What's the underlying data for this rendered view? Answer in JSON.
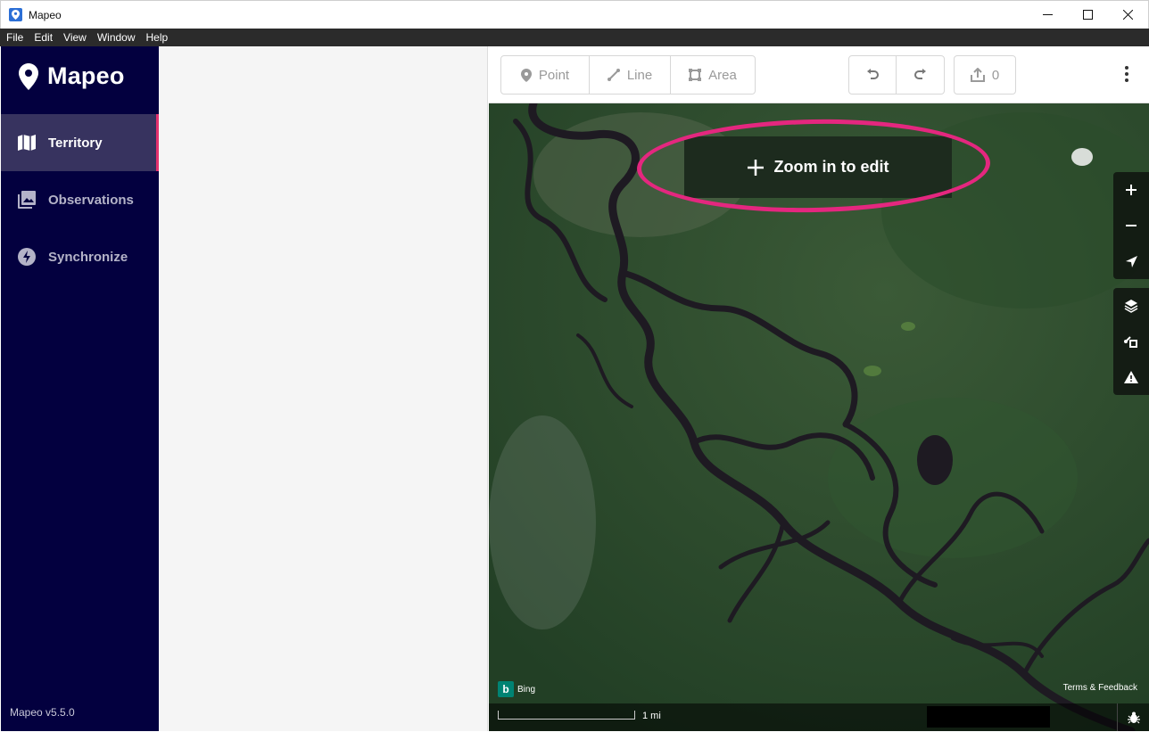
{
  "window": {
    "title": "Mapeo"
  },
  "menu": [
    "File",
    "Edit",
    "View",
    "Window",
    "Help"
  ],
  "sidebar": {
    "brand": "Mapeo",
    "items": [
      {
        "label": "Territory",
        "icon": "map-icon",
        "active": true
      },
      {
        "label": "Observations",
        "icon": "photo-library-icon",
        "active": false
      },
      {
        "label": "Synchronize",
        "icon": "flash-icon",
        "active": false
      }
    ],
    "version": "Mapeo v5.5.0"
  },
  "toolbar": {
    "point_label": "Point",
    "line_label": "Line",
    "area_label": "Area",
    "upload_count": "0"
  },
  "map": {
    "zoom_banner": "Zoom in to edit",
    "attribution": "Bing",
    "terms": "Terms & Feedback",
    "scale_label": "1 mi",
    "highlight_color": "#e4277f"
  }
}
